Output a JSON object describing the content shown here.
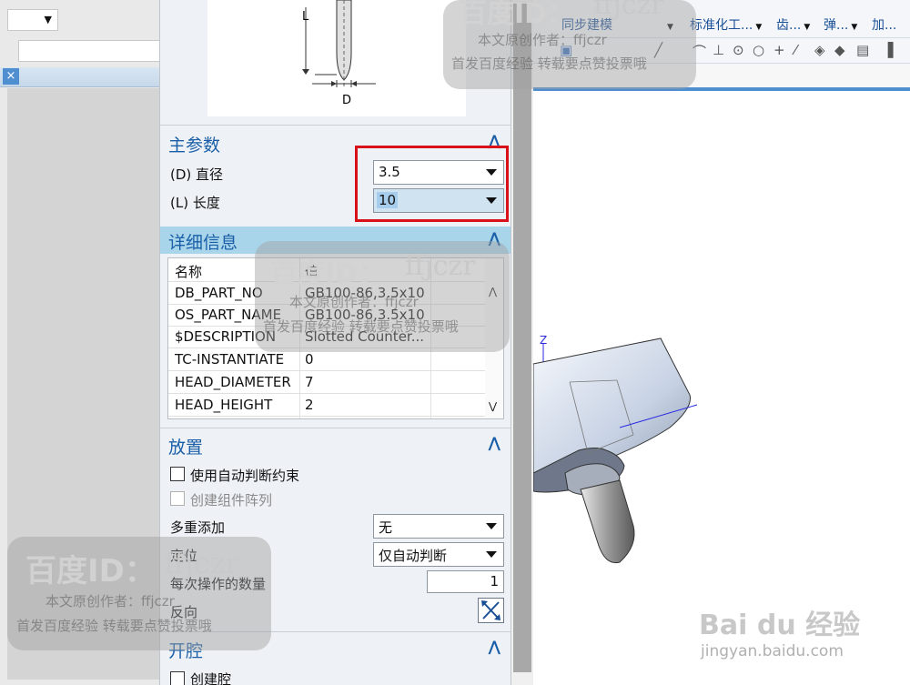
{
  "dialog": {
    "image_labels": {
      "length": "L",
      "diameter": "D"
    },
    "main_params": {
      "title": "主参数",
      "diameter_label": "(D) 直径",
      "diameter_value": "3.5",
      "length_label": "(L) 长度",
      "length_value": "10"
    },
    "details": {
      "title": "详细信息",
      "columns": [
        "名称",
        "值"
      ],
      "rows": [
        [
          "DB_PART_NO",
          "GB100-86,3.5x10"
        ],
        [
          "OS_PART_NAME",
          "GB100-86,3.5x10"
        ],
        [
          "$DESCRIPTION",
          "Slotted Counter..."
        ],
        [
          "TC-INSTANTIATE",
          "0"
        ],
        [
          "HEAD_DIAMETER",
          "7"
        ],
        [
          "HEAD_HEIGHT",
          "2"
        ]
      ]
    },
    "placement": {
      "title": "放置",
      "auto_constraint": "使用自动判断约束",
      "create_array": "创建组件阵列",
      "multi_add_label": "多重添加",
      "multi_add_value": "无",
      "position_label": "定位",
      "position_value": "仅自动判断",
      "qty_label": "每次操作的数量",
      "qty_value": "1",
      "reverse_label": "反向"
    },
    "cavity": {
      "title": "开腔",
      "create_cavity": "创建腔"
    }
  },
  "toolbar": {
    "items": [
      {
        "label": "同步建模"
      },
      {
        "label": "标准化工..."
      },
      {
        "label": "齿..."
      },
      {
        "label": "弹..."
      },
      {
        "label": "加..."
      }
    ]
  },
  "viewport": {
    "axis_label": "Z"
  },
  "watermark": {
    "brand": "百度ID：",
    "id": "ffjczr",
    "line1": "本文原创作者：ffjczr",
    "line2": "首发百度经验 转载要点赞投票哦",
    "logo_text": "Bai du 经验",
    "url": "jingyan.baidu.com"
  },
  "colors": {
    "accent": "#1a5fa8",
    "highlight_box": "#d8101a",
    "section_highlight": "#a9d5ea"
  }
}
